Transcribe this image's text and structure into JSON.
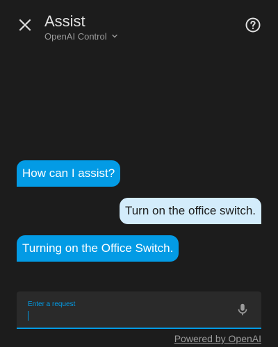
{
  "header": {
    "title": "Assist",
    "pipeline": "OpenAI Control",
    "close_icon": "close-icon",
    "help_icon": "help-circle-icon",
    "dropdown_icon": "chevron-down-icon"
  },
  "messages": [
    {
      "from": "assistant",
      "text": "How can I assist?"
    },
    {
      "from": "user",
      "text": "Turn on the office switch."
    },
    {
      "from": "assistant",
      "text": "Turning on the Office Switch."
    }
  ],
  "input": {
    "label": "Enter a request",
    "value": "",
    "mic_icon": "microphone-icon"
  },
  "footer": {
    "powered_by": "Powered by OpenAI"
  },
  "colors": {
    "background": "#1c1c1c",
    "accent": "#039be5",
    "user_bubble": "#d3ecfb",
    "input_bg": "#2a2a2a"
  }
}
